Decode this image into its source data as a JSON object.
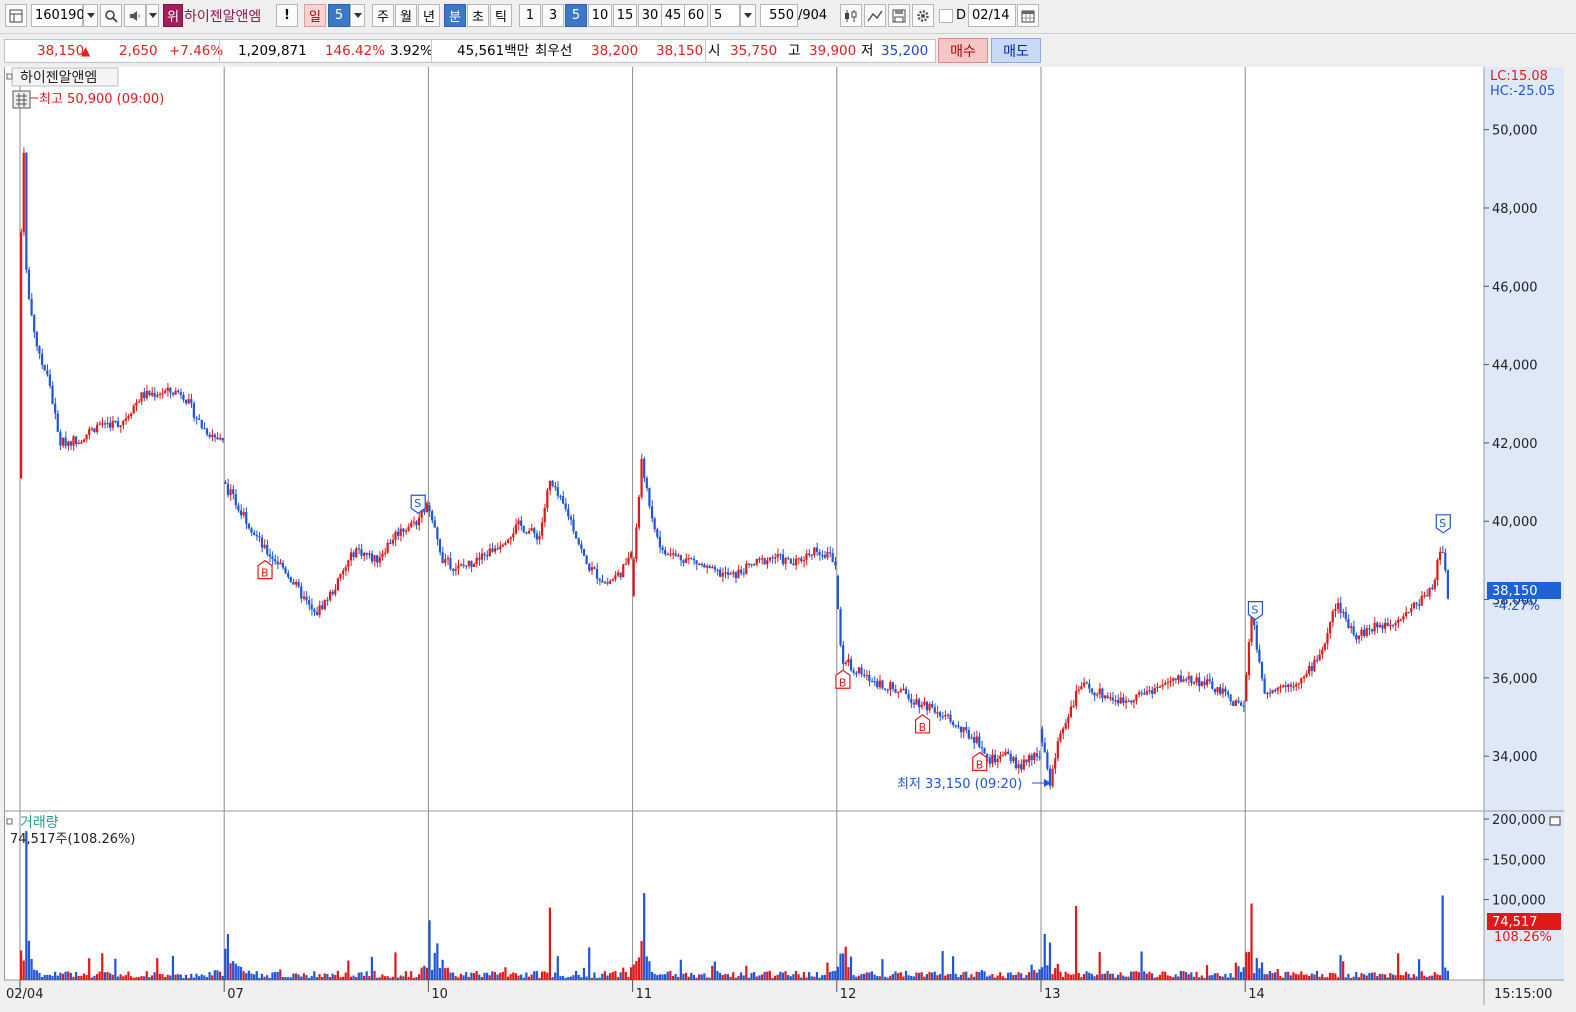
{
  "toolbar": {
    "code": "160190",
    "rank_badge": "위",
    "stock_name": "하이젠알앤엠",
    "warn_label": "!",
    "day_label": "일",
    "day_value": "5",
    "week_label": "주",
    "month_label": "월",
    "year_label": "년",
    "minute_label": "분",
    "second_label": "초",
    "tick_label": "틱",
    "intervals": [
      "1",
      "3",
      "5",
      "10",
      "15",
      "30",
      "45",
      "60"
    ],
    "selected_interval": "5",
    "period_value": "5",
    "count_value": "550",
    "count_total": "/904",
    "d_label": "D",
    "date_value": "02/14"
  },
  "quote": {
    "price": "38,150",
    "change_arrow": "▲",
    "change": "2,650",
    "change_pct": "+7.46%",
    "volume": "1,209,871",
    "volume_ratio": "146.42%",
    "turnover": "3.92%",
    "amount": "45,561백만",
    "best_bid_label": "최우선",
    "best_ask": "38,200",
    "best_bid": "38,150",
    "open_label": "시",
    "open": "35,750",
    "high_label": "고",
    "high": "39,900",
    "low_label": "저",
    "low": "35,200",
    "buy_label": "매수",
    "sell_label": "매도"
  },
  "colors": {
    "up": "#e01818",
    "down": "#1f55d8",
    "grid": "#8c8c8c",
    "axis_bg": "#dfe8f6",
    "price_box": "#1f62d6",
    "volume_box": "#e01818"
  },
  "chart_data": {
    "type": "candlestick",
    "price_panel": {
      "title": "하이젠알앤엠",
      "ylim": [
        32600,
        51600
      ],
      "yticks": [
        34000,
        36000,
        38000,
        40000,
        42000,
        44000,
        46000,
        48000,
        50000
      ],
      "ytick_labels": [
        "34,000",
        "36,000",
        "38,000",
        "40,000",
        "42,000",
        "44,000",
        "46,000",
        "48,000",
        "50,000"
      ],
      "lc_label": "LC:15.08",
      "hc_label": "HC:-25.05",
      "high_annotation": "최고 50,900 (09:00)",
      "low_annotation": "최저 33,150 (09:20)",
      "current_label": "38,150",
      "current_pct_label": "-4.27%",
      "current": 38150
    },
    "volume_panel": {
      "title": "거래량",
      "info": "74,517주(108.26%)",
      "ylim": [
        0,
        210000
      ],
      "yticks": [
        100000,
        150000,
        200000
      ],
      "ytick_labels": [
        "100,000",
        "150,000",
        "200,000"
      ],
      "current_label": "74,517",
      "current_pct_label": "108.26%",
      "current": 74517
    },
    "x_labels": [
      "02/04",
      "07",
      "10",
      "11",
      "12",
      "13",
      "14"
    ],
    "time_label": "15:15:00",
    "days": [
      {
        "label": "02/04",
        "open": 41000,
        "close": 41900,
        "low": 41200,
        "high": 50900,
        "path": [
          [
            0,
            41100
          ],
          [
            0.02,
            50900
          ],
          [
            0.04,
            46000
          ],
          [
            0.1,
            44200
          ],
          [
            0.15,
            43600
          ],
          [
            0.2,
            42000
          ],
          [
            0.3,
            42100
          ],
          [
            0.4,
            42500
          ],
          [
            0.5,
            42500
          ],
          [
            0.6,
            43200
          ],
          [
            0.7,
            43300
          ],
          [
            0.8,
            43300
          ],
          [
            0.9,
            42400
          ],
          [
            1,
            42000
          ]
        ]
      },
      {
        "label": "07",
        "open": 41000,
        "close": 40400,
        "low": 37400,
        "high": 41100,
        "path": [
          [
            0,
            41000
          ],
          [
            0.1,
            40200
          ],
          [
            0.2,
            39300
          ],
          [
            0.3,
            38800
          ],
          [
            0.4,
            38000
          ],
          [
            0.45,
            37600
          ],
          [
            0.55,
            38300
          ],
          [
            0.65,
            39300
          ],
          [
            0.75,
            39000
          ],
          [
            0.85,
            39700
          ],
          [
            0.95,
            40000
          ],
          [
            1,
            40400
          ]
        ]
      },
      {
        "label": "10",
        "open": 40400,
        "close": 39200,
        "low": 37800,
        "high": 41800,
        "path": [
          [
            0,
            40400
          ],
          [
            0.08,
            39000
          ],
          [
            0.15,
            38800
          ],
          [
            0.25,
            39000
          ],
          [
            0.35,
            39400
          ],
          [
            0.45,
            39900
          ],
          [
            0.55,
            39600
          ],
          [
            0.6,
            41000
          ],
          [
            0.7,
            40100
          ],
          [
            0.78,
            38900
          ],
          [
            0.88,
            38400
          ],
          [
            0.95,
            38700
          ],
          [
            1,
            39200
          ]
        ]
      },
      {
        "label": "11",
        "open": 38100,
        "close": 39100,
        "low": 38000,
        "high": 41500,
        "path": [
          [
            0,
            38100
          ],
          [
            0.05,
            41500
          ],
          [
            0.1,
            40200
          ],
          [
            0.15,
            39200
          ],
          [
            0.3,
            39000
          ],
          [
            0.4,
            38700
          ],
          [
            0.5,
            38600
          ],
          [
            0.6,
            38900
          ],
          [
            0.7,
            39100
          ],
          [
            0.8,
            38900
          ],
          [
            0.9,
            39300
          ],
          [
            1,
            39000
          ]
        ]
      },
      {
        "label": "12",
        "open": 39000,
        "close": 34100,
        "low": 33150,
        "high": 39000,
        "path": [
          [
            0,
            38600
          ],
          [
            0.03,
            36500
          ],
          [
            0.15,
            36000
          ],
          [
            0.3,
            35700
          ],
          [
            0.4,
            35400
          ],
          [
            0.5,
            35200
          ],
          [
            0.6,
            34700
          ],
          [
            0.7,
            34400
          ],
          [
            0.75,
            33900
          ],
          [
            0.85,
            34000
          ],
          [
            0.9,
            33700
          ],
          [
            1,
            34100
          ]
        ]
      },
      {
        "label": "13",
        "open": 34700,
        "close": 35200,
        "low": 33150,
        "high": 36100,
        "path": [
          [
            0,
            34700
          ],
          [
            0.05,
            33300
          ],
          [
            0.1,
            34600
          ],
          [
            0.2,
            35800
          ],
          [
            0.3,
            35600
          ],
          [
            0.4,
            35400
          ],
          [
            0.5,
            35600
          ],
          [
            0.6,
            35800
          ],
          [
            0.7,
            36000
          ],
          [
            0.8,
            35900
          ],
          [
            0.9,
            35600
          ],
          [
            1,
            35200
          ]
        ]
      },
      {
        "label": "14",
        "open": 35750,
        "close": 38150,
        "low": 35200,
        "high": 39900,
        "path": [
          [
            0,
            35400
          ],
          [
            0.04,
            37600
          ],
          [
            0.1,
            35700
          ],
          [
            0.2,
            35800
          ],
          [
            0.3,
            36000
          ],
          [
            0.4,
            36900
          ],
          [
            0.45,
            37900
          ],
          [
            0.55,
            37100
          ],
          [
            0.65,
            37300
          ],
          [
            0.75,
            37500
          ],
          [
            0.85,
            37900
          ],
          [
            0.93,
            38400
          ],
          [
            0.97,
            39500
          ],
          [
            1,
            38150
          ]
        ]
      }
    ],
    "signals": [
      {
        "day": 1,
        "t": 0.2,
        "type": "B"
      },
      {
        "day": 1,
        "t": 0.95,
        "type": "S"
      },
      {
        "day": 4,
        "t": 0.03,
        "type": "B"
      },
      {
        "day": 4,
        "t": 0.42,
        "type": "B"
      },
      {
        "day": 4,
        "t": 0.7,
        "type": "B"
      },
      {
        "day": 6,
        "t": 0.05,
        "type": "S"
      },
      {
        "day": 6,
        "t": 0.97,
        "type": "S"
      }
    ],
    "volume_spikes": [
      {
        "day": 0,
        "t": 0.02,
        "v": 185000
      },
      {
        "day": 2,
        "t": 0.6,
        "v": 90000
      },
      {
        "day": 3,
        "t": 0.05,
        "v": 108000
      },
      {
        "day": 5,
        "t": 0.17,
        "v": 92000
      },
      {
        "day": 6,
        "t": 0.03,
        "v": 95000
      },
      {
        "day": 6,
        "t": 0.97,
        "v": 105000
      }
    ]
  }
}
